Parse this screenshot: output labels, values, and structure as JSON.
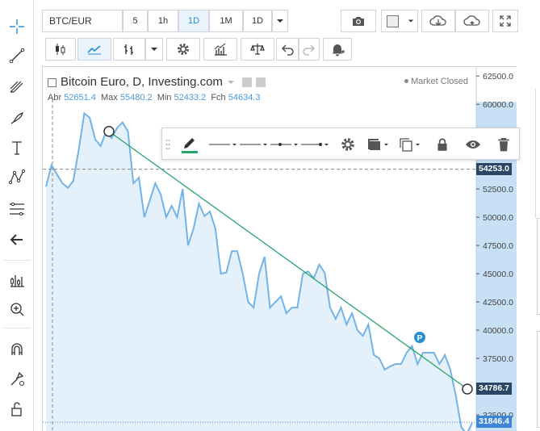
{
  "toolbar": {
    "symbol": "BTC/EUR",
    "intervals": [
      "5",
      "1h",
      "1D",
      "1M",
      "1D"
    ],
    "active_interval_index": 2
  },
  "legend": {
    "title": "Bitcoin Euro, D, Investing.com",
    "market_status": "Market Closed",
    "open_label": "Abr",
    "open_value": "52651.4",
    "high_label": "Max",
    "high_value": "55480.2",
    "low_label": "Min",
    "low_value": "52433.2",
    "close_label": "Fch",
    "close_value": "54634.3"
  },
  "price_scale": {
    "ticks": [
      "62500.0",
      "60000.0",
      "52500.0",
      "50000.0",
      "47500.0",
      "45000.0",
      "42500.0",
      "40000.0",
      "37500.0",
      "32500.0"
    ],
    "crosshair_label": "54253.0",
    "trendline_label": "34786.7",
    "last_price_label": "31846.4"
  },
  "markers": {
    "p_badge": "P"
  },
  "icons": {
    "left": [
      "crosshair-icon",
      "trendline-icon",
      "pitchfork-icon",
      "brush-icon",
      "text-icon",
      "pattern-icon",
      "fib-icon",
      "back-arrow-icon",
      "measure-icon",
      "zoom-icon",
      "magnet-icon",
      "lock-drawings-icon",
      "unlock-icon"
    ],
    "top": [
      "candles-icon",
      "line-chart-icon",
      "bars-icon",
      "chevron-down-icon",
      "gear-icon",
      "indicators-icon",
      "scales-icon",
      "undo-icon",
      "redo-icon",
      "alert-icon",
      "camera-icon",
      "color-square-icon",
      "cloud-download-icon",
      "cloud-upload-icon",
      "fullscreen-icon"
    ],
    "drawing": [
      "pencil-icon",
      "line-style-icon",
      "line-width-icon",
      "line-end-icon",
      "line-arrow-icon",
      "gear-icon",
      "fill-icon",
      "clone-icon",
      "lock-icon",
      "eye-icon",
      "trash-icon"
    ]
  },
  "colors": {
    "series_line": "#74b3e6",
    "area_fill": "#e4f1fb",
    "trendline": "#2aa56a",
    "accent_blue": "#2a8ed1",
    "price_axis": "#c7e0f5",
    "label_dark": "#2a4566",
    "label_blue": "#3d86d8"
  },
  "chart_data": {
    "type": "area",
    "price_range": [
      31000,
      63300
    ],
    "series": [
      {
        "values": [
          52700,
          54600,
          53800,
          53000,
          52600,
          53200,
          56000,
          59200,
          58800,
          56900,
          56300,
          57600,
          57000,
          57900,
          58400,
          57600,
          53000,
          53500,
          50000,
          51500,
          53000,
          52000,
          50000,
          51000,
          50000,
          52500,
          47500,
          49000,
          51200,
          50100,
          50500,
          49000,
          45000,
          45100,
          47000,
          47000,
          45000,
          42500,
          42000,
          45000,
          46500,
          42000,
          42500,
          43000,
          41500,
          42000,
          42000,
          45000,
          45200,
          44600,
          45800,
          45100,
          42000,
          41000,
          42000,
          40500,
          41500,
          40000,
          39500,
          40500,
          37800,
          37500,
          36500,
          36800,
          37000,
          37000,
          38000,
          38600,
          37000,
          38000,
          38000,
          38000,
          37000,
          37800,
          36500,
          34200,
          31400,
          30800,
          31800
        ],
        "trendline": {
          "start": 57600,
          "end": 34786.7
        }
      }
    ]
  }
}
